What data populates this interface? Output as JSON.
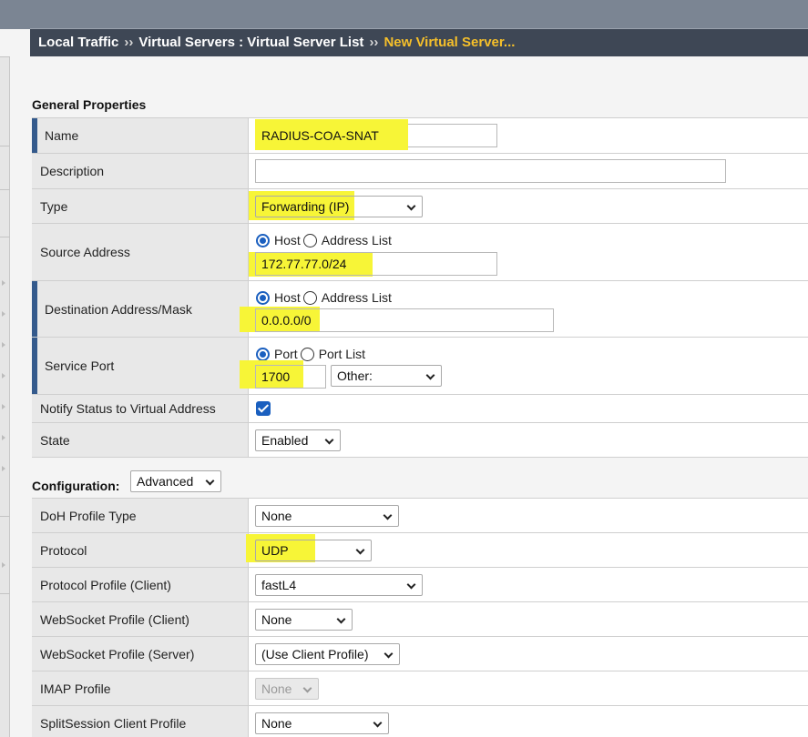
{
  "breadcrumb": {
    "part1": "Local Traffic",
    "sep1": "››",
    "part2": "Virtual Servers : Virtual Server List",
    "sep2": "››",
    "current": "New Virtual Server..."
  },
  "general": {
    "title": "General Properties",
    "rows": {
      "name": {
        "label": "Name",
        "value": "RADIUS-COA-SNAT"
      },
      "description": {
        "label": "Description",
        "value": ""
      },
      "type": {
        "label": "Type",
        "value": "Forwarding (IP)"
      },
      "source": {
        "label": "Source Address",
        "radio1": "Host",
        "radio2": "Address List",
        "value": "172.77.77.0/24"
      },
      "destination": {
        "label": "Destination Address/Mask",
        "radio1": "Host",
        "radio2": "Address List",
        "value": "0.0.0.0/0"
      },
      "service_port": {
        "label": "Service Port",
        "radio1": "Port",
        "radio2": "Port List",
        "value": "1700",
        "select": "Other:"
      },
      "notify": {
        "label": "Notify Status to Virtual Address",
        "checked": true
      },
      "state": {
        "label": "State",
        "value": "Enabled"
      }
    }
  },
  "configuration": {
    "title": "Configuration:",
    "mode": "Advanced",
    "rows": {
      "doh": {
        "label": "DoH Profile Type",
        "value": "None"
      },
      "protocol": {
        "label": "Protocol",
        "value": "UDP"
      },
      "protocol_profile_client": {
        "label": "Protocol Profile (Client)",
        "value": "fastL4"
      },
      "websocket_client": {
        "label": "WebSocket Profile (Client)",
        "value": "None"
      },
      "websocket_server": {
        "label": "WebSocket Profile (Server)",
        "value": "(Use Client Profile)"
      },
      "imap": {
        "label": "IMAP Profile",
        "value": "None"
      },
      "splitsession": {
        "label": "SplitSession Client Profile",
        "value": "None"
      }
    }
  },
  "colors": {
    "highlight": "#f7f537",
    "breadcrumb_bg": "#3e4755",
    "breadcrumb_current": "#f6c02a",
    "required_marker": "#345a8c",
    "radio_selected": "#1a5fbf"
  }
}
